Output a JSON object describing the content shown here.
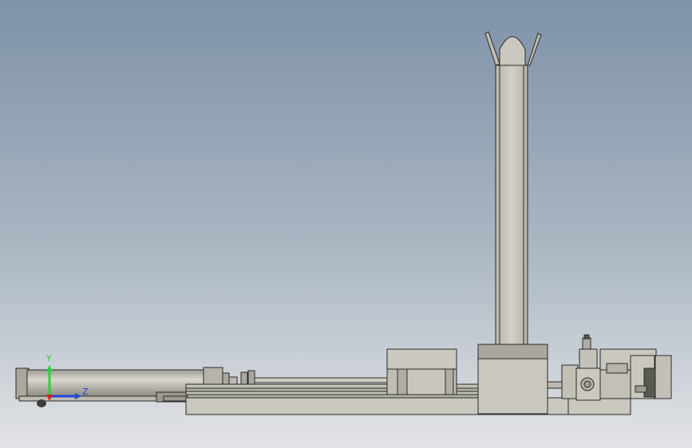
{
  "viewport": {
    "background_top": "#7f92a9",
    "background_bottom": "#e2e3e6"
  },
  "model": {
    "part_fill": "#c8c6bc",
    "part_stroke": "#2a2a28",
    "shadow_fill": "#8e8c82",
    "dark_fill": "#5a5953"
  },
  "triad": {
    "y_label": "Y",
    "z_label": "Z",
    "y_color": "#29d33a",
    "z_color": "#2346e0",
    "x_color": "#e01b1b"
  }
}
